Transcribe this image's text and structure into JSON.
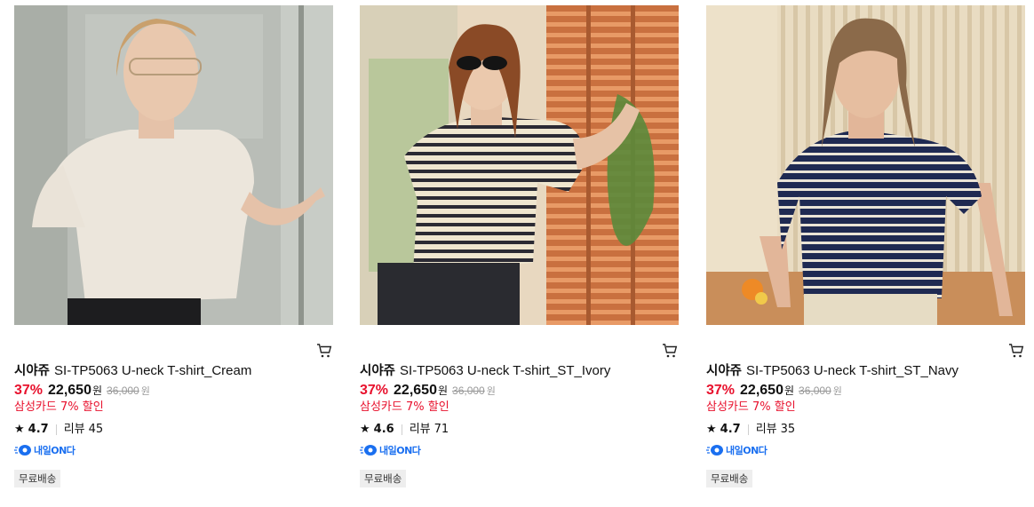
{
  "products": [
    {
      "brand": "시야쥬",
      "name": "SI-TP5063 U-neck T-shirt_Cream",
      "discount_rate": "37%",
      "price": "22,650",
      "currency": "원",
      "original_price": "36,000",
      "card_discount": "삼성카드 7% 할인",
      "rating": "4.7",
      "review_label": "리뷰",
      "review_count": "45",
      "delivery_badge": "내일ON다",
      "tag": "무료배송",
      "shirt_style": "cream"
    },
    {
      "brand": "시야쥬",
      "name": "SI-TP5063 U-neck T-shirt_ST_Ivory",
      "discount_rate": "37%",
      "price": "22,650",
      "currency": "원",
      "original_price": "36,000",
      "card_discount": "삼성카드 7% 할인",
      "rating": "4.6",
      "review_label": "리뷰",
      "review_count": "71",
      "delivery_badge": "내일ON다",
      "tag": "무료배송",
      "shirt_style": "ivory-stripe"
    },
    {
      "brand": "시야쥬",
      "name": "SI-TP5063 U-neck T-shirt_ST_Navy",
      "discount_rate": "37%",
      "price": "22,650",
      "currency": "원",
      "original_price": "36,000",
      "card_discount": "삼성카드 7% 할인",
      "rating": "4.7",
      "review_label": "리뷰",
      "review_count": "35",
      "delivery_badge": "내일ON다",
      "tag": "무료배송",
      "shirt_style": "navy-stripe"
    }
  ],
  "colors": {
    "discount_red": "#e8112d",
    "badge_blue": "#1a6ff0",
    "tag_bg": "#eeeeee"
  },
  "icons": {
    "cart": "cart-icon",
    "star": "star-icon",
    "delivery": "delivery-truck-icon"
  }
}
